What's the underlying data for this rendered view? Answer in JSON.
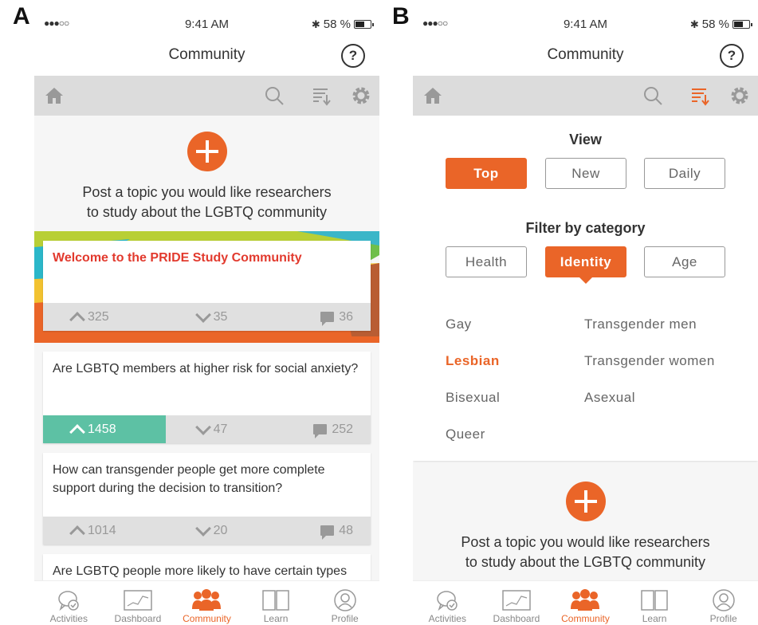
{
  "labels": {
    "a": "A",
    "b": "B"
  },
  "colors": {
    "accent": "#ea6528",
    "upvoted": "#5dc1a4",
    "toolbar": "#dcdcdc"
  },
  "status": {
    "signal": "●●●○○",
    "time": "9:41 AM",
    "battery": "58 %"
  },
  "nav": {
    "title": "Community",
    "help": "?"
  },
  "toolbar_icons": [
    "home-icon",
    "search-icon",
    "sort-icon",
    "gear-icon"
  ],
  "cta": {
    "line1": "Post a topic you would like researchers",
    "line2": "to study about the LGBTQ community"
  },
  "posts": [
    {
      "title": "Welcome to the PRIDE Study Community",
      "up": "325",
      "down": "35",
      "comments": "36"
    },
    {
      "title": "Are LGBTQ members at higher risk for social anxiety?",
      "up": "1458",
      "down": "47",
      "comments": "252"
    },
    {
      "title": "How can transgender people get more complete support during the decision to transition?",
      "up": "1014",
      "down": "20",
      "comments": "48"
    },
    {
      "title": "Are LGBTQ people more likely to have certain types"
    }
  ],
  "view": {
    "heading": "View",
    "options": [
      "Top",
      "New",
      "Daily"
    ],
    "selected": "Top"
  },
  "filter": {
    "heading": "Filter by category",
    "options": [
      "Health",
      "Identity",
      "Age"
    ],
    "selected": "Identity"
  },
  "categories": {
    "left": [
      "Gay",
      "Lesbian",
      "Bisexual",
      "Queer"
    ],
    "right": [
      "Transgender men",
      "Transgender women",
      "Asexual"
    ],
    "selected": "Lesbian"
  },
  "tabs": [
    {
      "label": "Activities",
      "icon": "activities-icon"
    },
    {
      "label": "Dashboard",
      "icon": "dashboard-icon"
    },
    {
      "label": "Community",
      "icon": "community-icon"
    },
    {
      "label": "Learn",
      "icon": "learn-icon"
    },
    {
      "label": "Profile",
      "icon": "profile-icon"
    }
  ],
  "active_tab": "Community"
}
